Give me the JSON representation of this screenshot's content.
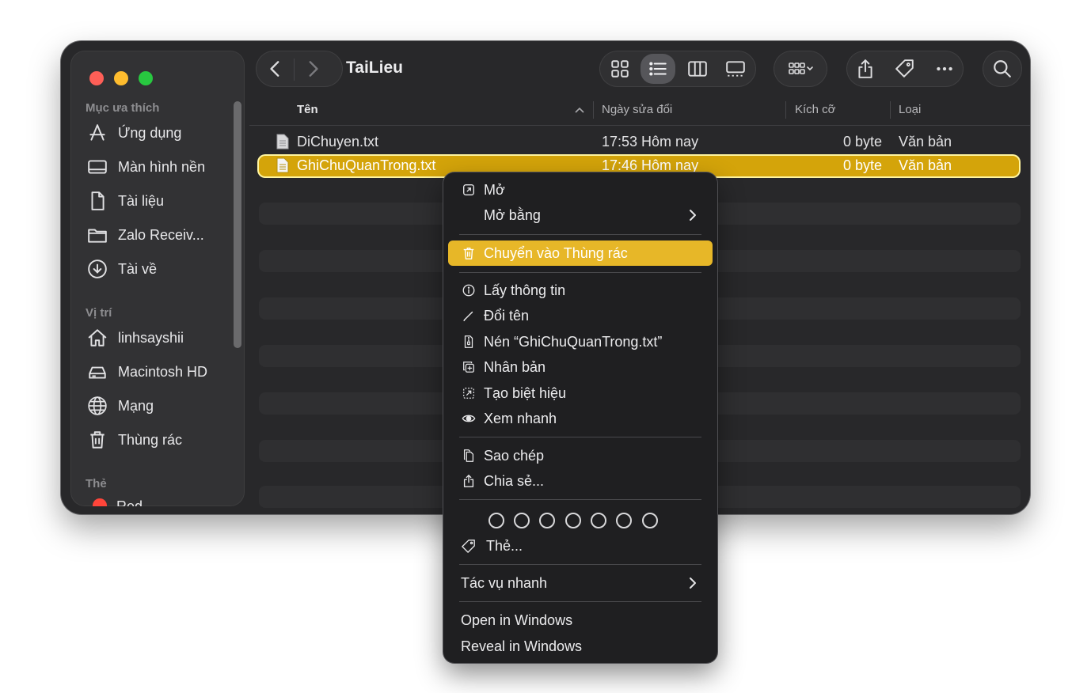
{
  "window": {
    "title": "TaiLieu"
  },
  "sidebar": {
    "favorites_heading": "Mục ưa thích",
    "favorites": [
      {
        "label": "Ứng dụng",
        "icon": "apps-icon"
      },
      {
        "label": "Màn hình nền",
        "icon": "desktop-icon"
      },
      {
        "label": "Tài liệu",
        "icon": "document-icon"
      },
      {
        "label": "Zalo Receiv...",
        "icon": "folder-icon"
      },
      {
        "label": "Tài về",
        "icon": "download-icon"
      }
    ],
    "locations_heading": "Vị trí",
    "locations": [
      {
        "label": "linhsayshii",
        "icon": "home-icon"
      },
      {
        "label": "Macintosh HD",
        "icon": "disk-icon"
      },
      {
        "label": "Mạng",
        "icon": "network-icon"
      },
      {
        "label": "Thùng rác",
        "icon": "trash-icon"
      }
    ],
    "tags_heading": "Thẻ",
    "tags": [
      {
        "label": "Red",
        "color": "#ff453a"
      }
    ]
  },
  "columns": {
    "name": "Tên",
    "modified": "Ngày sửa đổi",
    "size": "Kích cỡ",
    "kind": "Loại"
  },
  "files": [
    {
      "name": "DiChuyen.txt",
      "modified": "17:53 Hôm nay",
      "size": "0 byte",
      "kind": "Văn bản",
      "selected": false
    },
    {
      "name": "GhiChuQuanTrong.txt",
      "modified": "17:46 Hôm nay",
      "size": "0 byte",
      "kind": "Văn bản",
      "selected": true
    }
  ],
  "context_menu": {
    "open": "Mở",
    "open_with": "Mở bằng",
    "move_to_trash": "Chuyển vào Thùng rác",
    "get_info": "Lấy thông tin",
    "rename": "Đổi tên",
    "compress": "Nén “GhiChuQuanTrong.txt”",
    "duplicate": "Nhân bản",
    "make_alias": "Tạo biệt hiệu",
    "quick_look": "Xem nhanh",
    "copy": "Sao chép",
    "share": "Chia sẻ...",
    "tags": "Thẻ...",
    "quick_actions": "Tác vụ nhanh",
    "open_in_windows": "Open in Windows",
    "reveal_in_windows": "Reveal in Windows"
  },
  "colors": {
    "selection": "#d4a40a",
    "menu_highlight": "#e7b728",
    "window_bg": "#28282a"
  }
}
